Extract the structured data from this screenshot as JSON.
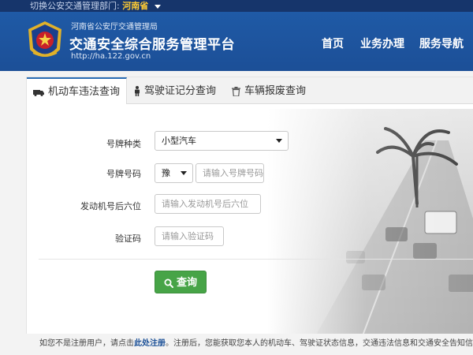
{
  "topbar": {
    "switch_label": "切换公安交通管理部门:",
    "province": "河南省"
  },
  "header": {
    "org": "河南省公安厅交通管理局",
    "title": "交通安全综合服务管理平台",
    "url": "http://ha.122.gov.cn",
    "nav": [
      "首页",
      "业务办理",
      "服务导航"
    ]
  },
  "tabs": [
    {
      "label": "机动车违法查询",
      "icon": "car-icon"
    },
    {
      "label": "驾驶证记分查询",
      "icon": "person-icon"
    },
    {
      "label": "车辆报废查询",
      "icon": "trash-icon"
    }
  ],
  "form": {
    "plate_type_label": "号牌种类",
    "plate_type_value": "小型汽车",
    "plate_number_label": "号牌号码",
    "plate_prefix_value": "豫",
    "plate_number_placeholder": "请输入号牌号码",
    "engine_label": "发动机号后六位",
    "engine_placeholder": "请输入发动机号后六位",
    "captcha_label": "验证码",
    "captcha_placeholder": "请输入验证码",
    "query_label": "查询"
  },
  "footer": {
    "pre": "如您不是注册用户，请点击",
    "link": "此处注册",
    "post": "。注册后，您能获取您本人的机动车、驾驶证状态信息，交通违法信息和交通安全告知信息"
  }
}
